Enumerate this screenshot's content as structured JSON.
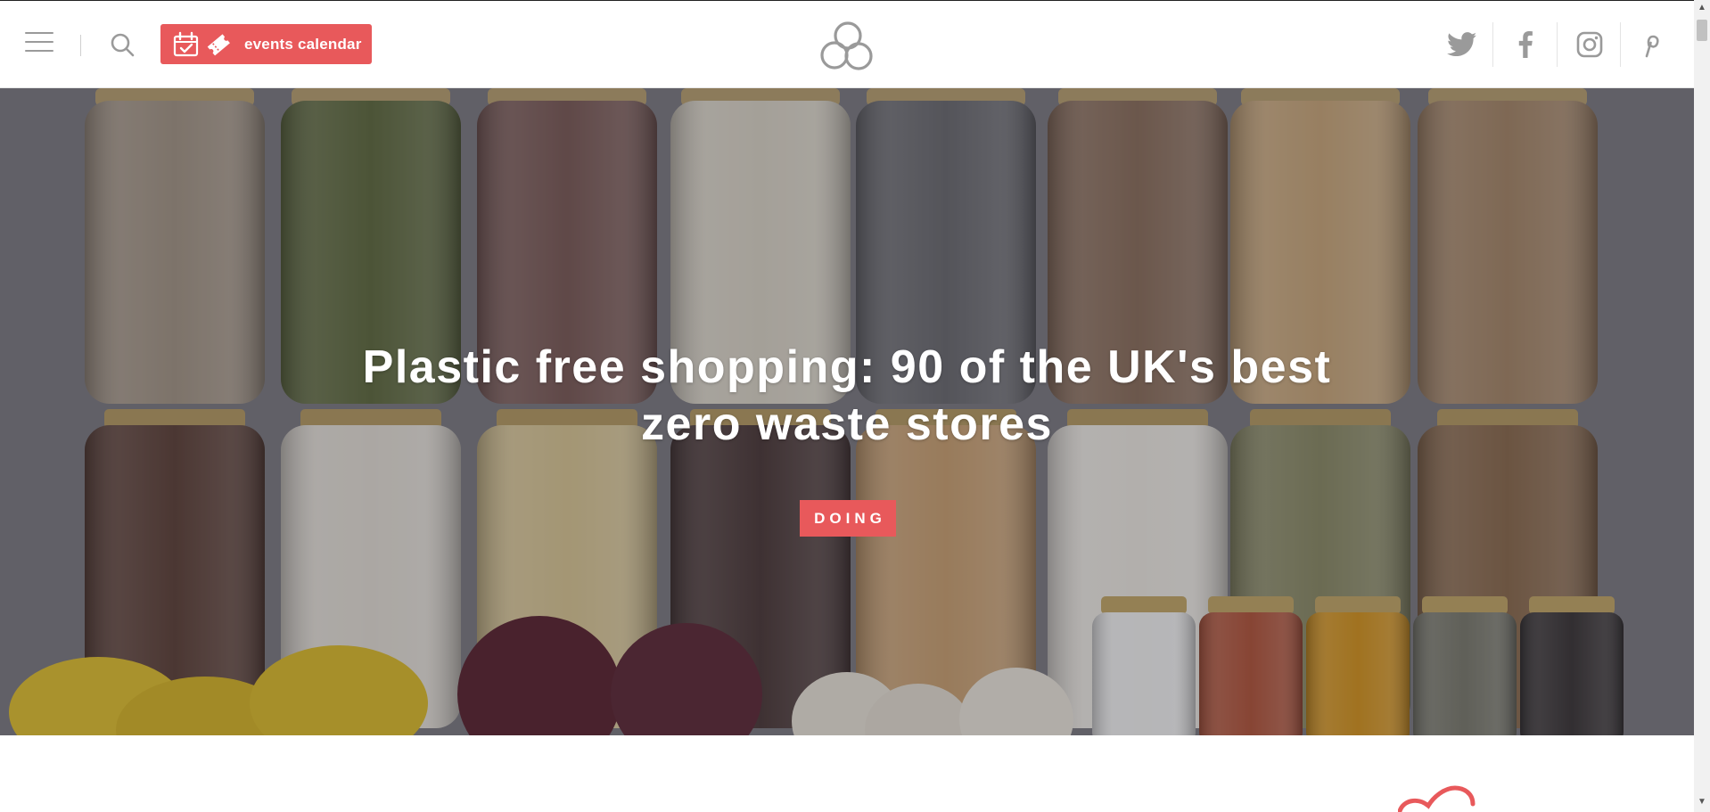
{
  "header": {
    "menu_icon": "hamburger-menu-icon",
    "search_icon": "search-icon",
    "events_button": {
      "label": "events calendar",
      "icons": [
        "calendar-check-icon",
        "ticket-icon"
      ]
    },
    "logo_icon": "three-circles-logo",
    "social": [
      {
        "name": "twitter",
        "icon": "twitter-icon"
      },
      {
        "name": "facebook",
        "icon": "facebook-icon"
      },
      {
        "name": "instagram",
        "icon": "instagram-icon"
      },
      {
        "name": "pinterest",
        "icon": "pinterest-icon"
      }
    ]
  },
  "hero": {
    "title": "Plastic free shopping: 90 of the UK's best zero waste stores",
    "category": "DOING"
  },
  "colors": {
    "accent": "#e8595b",
    "icon_gray": "#9a9a9a"
  }
}
